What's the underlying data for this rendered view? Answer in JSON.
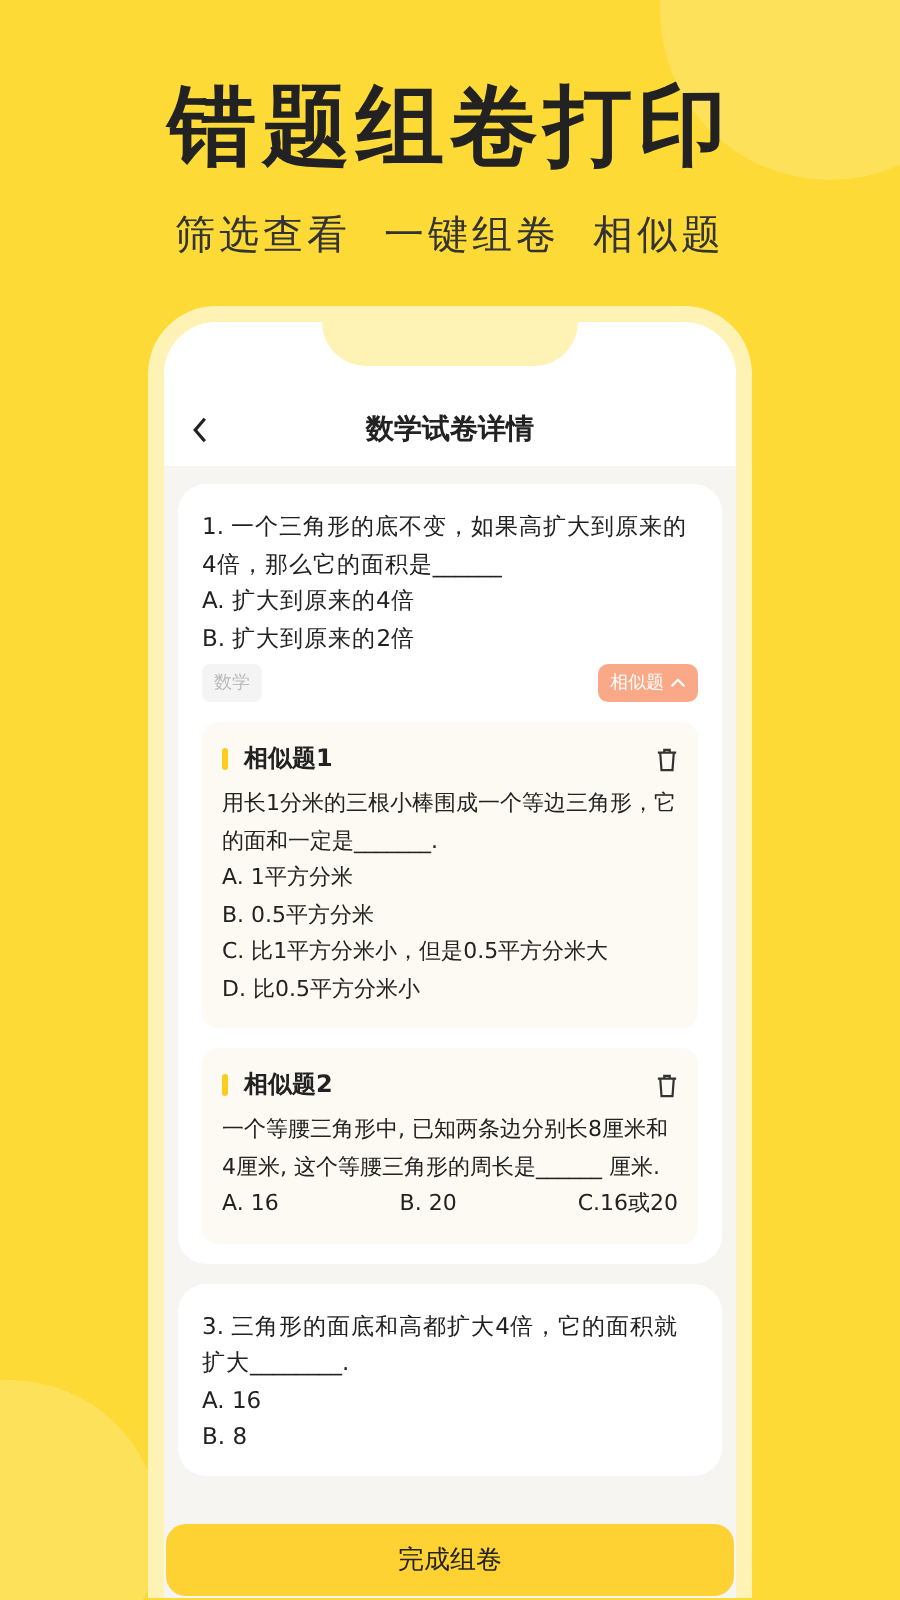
{
  "banner": {
    "title": "错题组卷打印",
    "subtitle": "筛选查看  一键组卷  相似题"
  },
  "header": {
    "title": "数学试卷详情"
  },
  "questions": [
    {
      "text": "1. 一个三角形的底不变，如果高扩大到原来的4倍，那么它的面积是______",
      "options": [
        "A. 扩大到原来的4倍",
        "B. 扩大到原来的2倍"
      ],
      "subject": "数学",
      "similar_toggle": {
        "label": "相似题",
        "expanded": true
      },
      "similar": [
        {
          "title": "相似题1",
          "text": "用长1分米的三根小棒围成一个等边三角形，它的面和一定是_______.",
          "kind": "stacked",
          "options": [
            "A. 1平方分米",
            "B. 0.5平方分米",
            "C. 比1平方分米小，但是0.5平方分米大",
            "D. 比0.5平方分米小"
          ]
        },
        {
          "title": "相似题2",
          "text": "一个等腰三角形中, 已知两条边分别长8厘米和4厘米, 这个等腰三角形的周长是______ 厘米.",
          "kind": "inline",
          "options": [
            "A. 16",
            "B. 20",
            "C.16或20"
          ]
        }
      ]
    },
    {
      "text": "3. 三角形的面底和高都扩大4倍，它的面积就扩大________.",
      "options": [
        "A. 16",
        "B. 8"
      ]
    }
  ],
  "footer_button": "完成组卷"
}
